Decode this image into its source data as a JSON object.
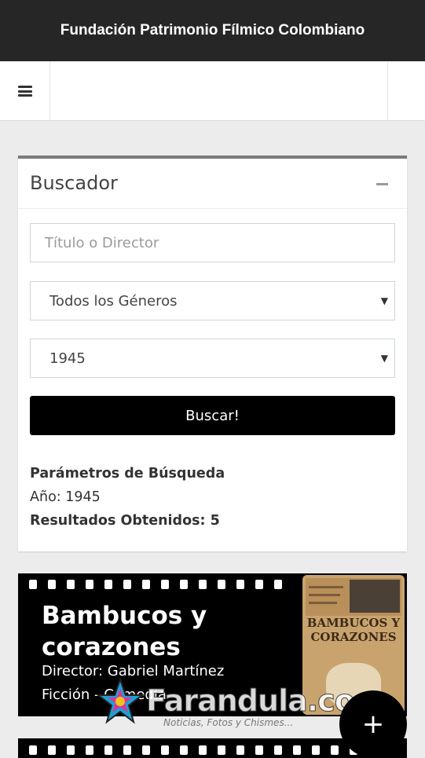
{
  "app": {
    "title": "Fundación Patrimonio Fílmico Colombiano"
  },
  "nav": {
    "menu_icon": "hamburger-icon"
  },
  "search": {
    "title": "Buscador",
    "collapse_icon": "minus-icon",
    "text_placeholder": "Título o Director",
    "genre_selected": "Todos los Géneros",
    "year_selected": "1945",
    "submit_label": "Buscar!"
  },
  "params": {
    "heading": "Parámetros de Búsqueda",
    "year_line": "Año: 1945",
    "results_line": "Resultados Obtenidos: 5"
  },
  "results": [
    {
      "title": "Bambucos y corazones",
      "director": "Director: Gabriel Martínez",
      "genre": "Ficción - Comedia",
      "poster_text": "BAMBUCOS Y CORAZONES"
    }
  ],
  "watermark": {
    "brand": "Farandula.co",
    "tagline": "Noticias, Fotos y Chismes..."
  },
  "fab": {
    "icon": "plus-icon",
    "label": "+"
  },
  "colors": {
    "titlebar": "#262626",
    "button": "#000000",
    "card_border": "#7a7a7a"
  }
}
